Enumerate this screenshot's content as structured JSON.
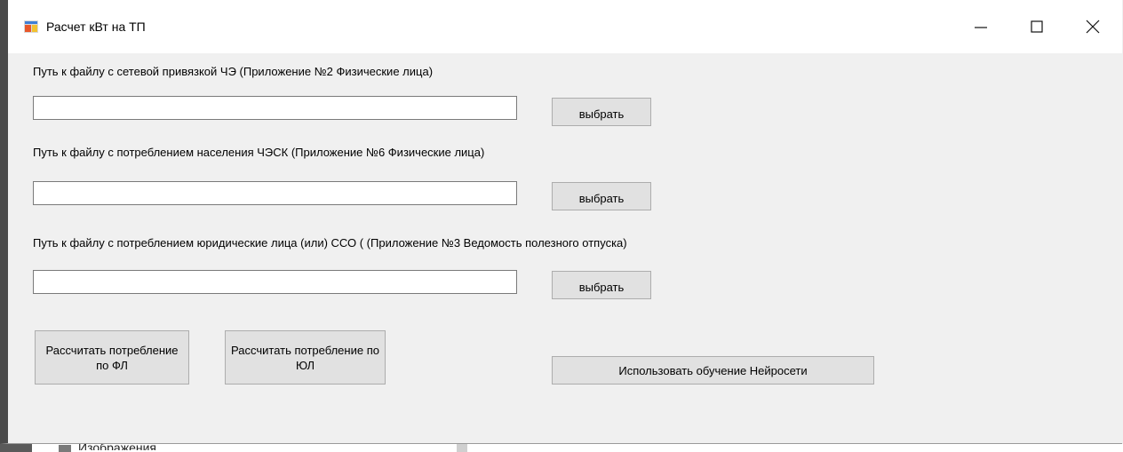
{
  "window": {
    "title": "Расчет кВт на ТП",
    "controls": {
      "minimize": "—",
      "maximize": "☐",
      "close": "✕"
    }
  },
  "fields": [
    {
      "label": "Путь к файлу с сетевой привязкой ЧЭ (Приложение №2 Физические лица)",
      "value": "",
      "button": "выбрать"
    },
    {
      "label": "Путь к файлу с потреблением населения ЧЭСК (Приложение №6 Физические лица)",
      "value": "",
      "button": "выбрать"
    },
    {
      "label": "Путь к файлу с потреблением юридические лица (или) ССО ( (Приложение №3 Ведомость полезного отпуска)",
      "value": "",
      "button": "выбрать"
    }
  ],
  "actions": {
    "calc_fl": "Рассчитать потребление по ФЛ",
    "calc_ul": "Рассчитать потребление по ЮЛ",
    "neural": "Использовать обучение Нейросети"
  },
  "background": {
    "partial_text": "Изображения"
  },
  "colors": {
    "window_bg": "#f0f0f0",
    "button_bg": "#e1e1e1",
    "button_border": "#adadad"
  }
}
